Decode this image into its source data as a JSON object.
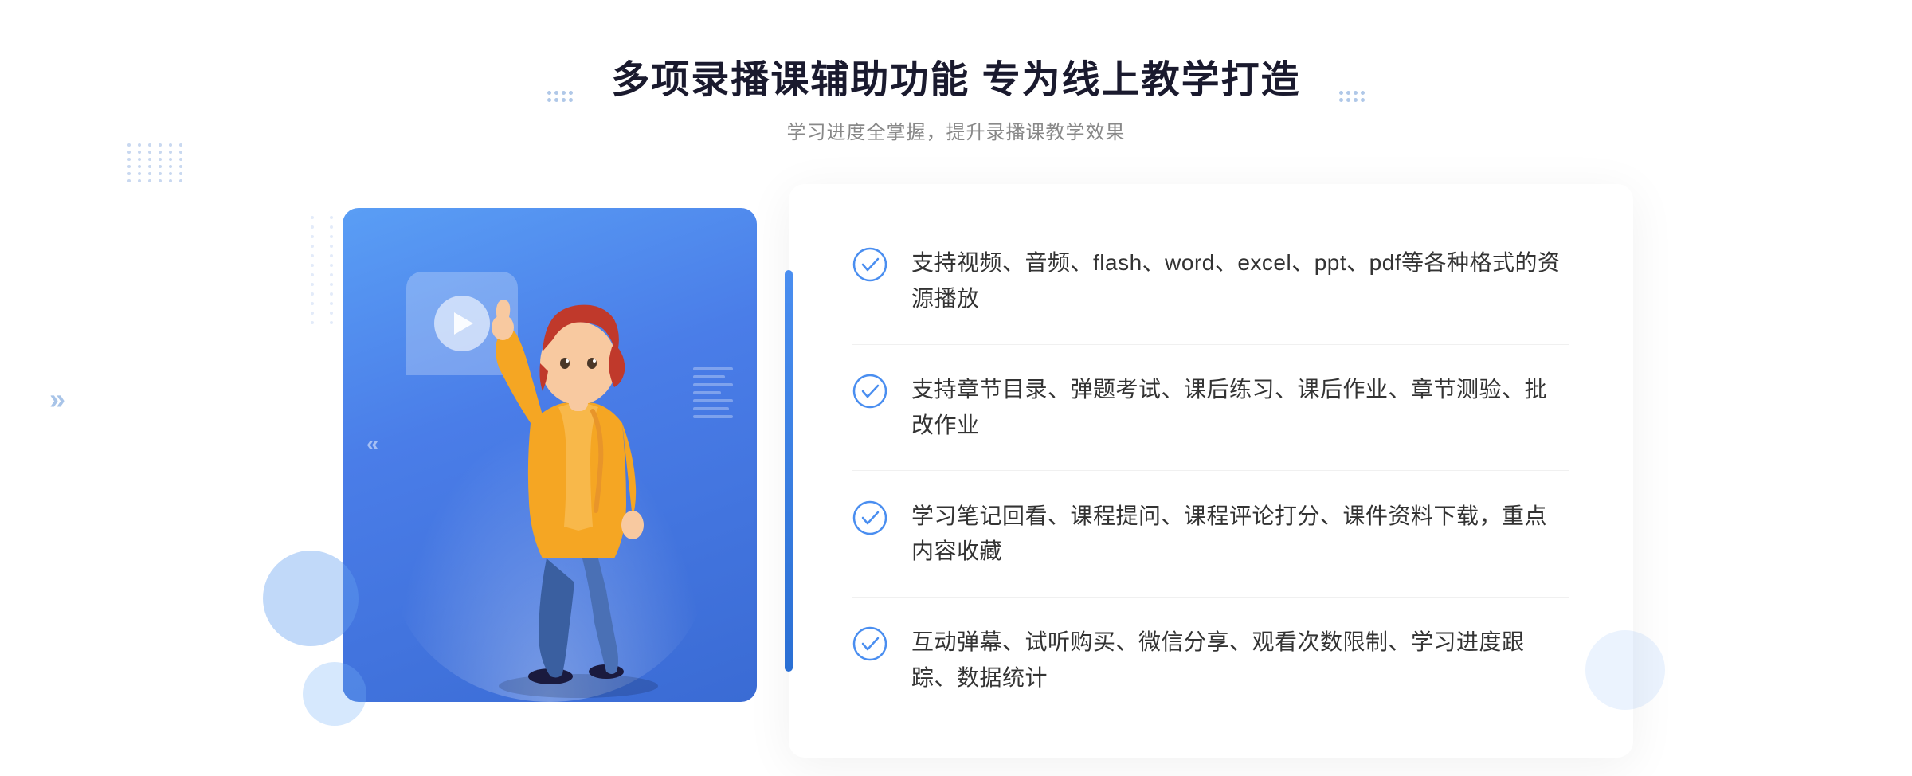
{
  "header": {
    "title": "多项录播课辅助功能 专为线上教学打造",
    "subtitle": "学习进度全掌握，提升录播课教学效果",
    "deco_left": ":::: ::::",
    "deco_right": ":::: ::::"
  },
  "features": [
    {
      "id": 1,
      "text": "支持视频、音频、flash、word、excel、ppt、pdf等各种格式的资源播放"
    },
    {
      "id": 2,
      "text": "支持章节目录、弹题考试、课后练习、课后作业、章节测验、批改作业"
    },
    {
      "id": 3,
      "text": "学习笔记回看、课程提问、课程评论打分、课件资料下载，重点内容收藏"
    },
    {
      "id": 4,
      "text": "互动弹幕、试听购买、微信分享、观看次数限制、学习进度跟踪、数据统计"
    }
  ],
  "colors": {
    "primary_blue": "#4a8ef0",
    "dark_blue": "#2a6fd4",
    "text_dark": "#333333",
    "text_gray": "#888888",
    "bg_white": "#ffffff"
  },
  "icons": {
    "check_circle": "check-circle-icon",
    "play": "play-icon",
    "chevron": "chevron-icon"
  }
}
